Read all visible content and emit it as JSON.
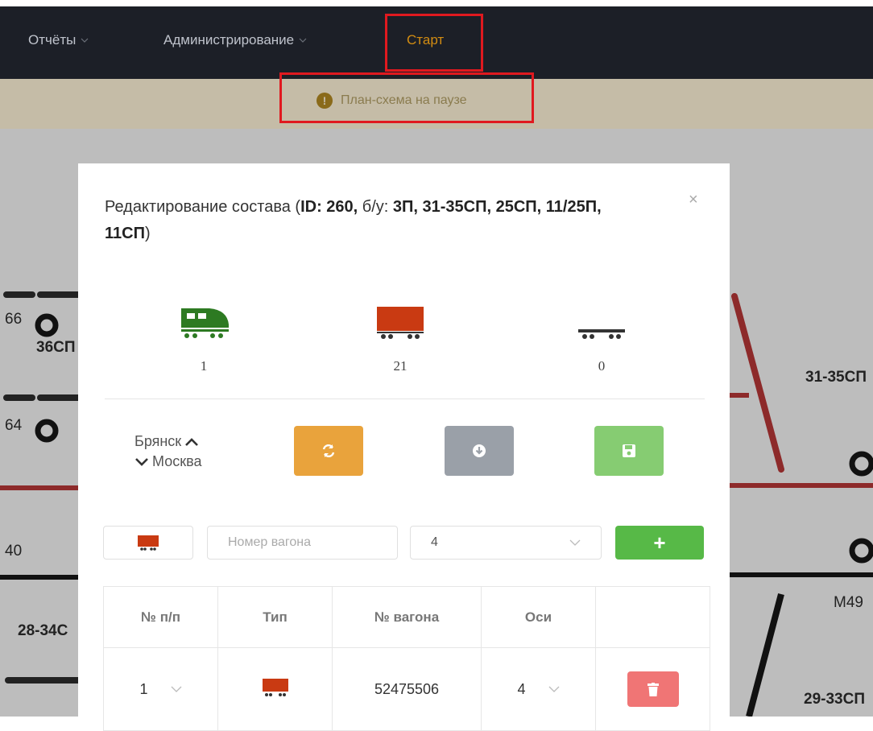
{
  "nav": {
    "reports": "Отчёты",
    "admin": "Администрирование",
    "start": "Старт"
  },
  "pause": {
    "text": "План-схема на паузе",
    "icon": "exclamation-circle-icon",
    "mark": "!"
  },
  "scheme_labels": {
    "l66": "66",
    "l36": "36СП",
    "l64": "64",
    "l40": "40",
    "l2834": "28-34С",
    "l3135": "31-35СП",
    "lm49": "М49",
    "l2933": "29-33СП"
  },
  "modal": {
    "title_prefix": "Редактирование состава (",
    "id_label": "ID: 260,",
    "bu_label": " б/у: ",
    "tracks": "3П, 31-35СП, 25СП, 11/25П,",
    "tracks2": "11СП",
    "title_suffix": ")",
    "close": "×",
    "counts": {
      "locomotive": "1",
      "wagon": "21",
      "platform": "0"
    },
    "route": {
      "from": "Брянск",
      "to": "Москва"
    },
    "buttons": {
      "refresh_icon": "refresh-icon",
      "download_icon": "download-icon",
      "save_icon": "save-icon"
    },
    "form": {
      "wagon_number_placeholder": "Номер вагона",
      "axles_value": "4",
      "add_label": "+"
    },
    "table": {
      "headers": [
        "№ п/п",
        "Тип",
        "№ вагона",
        "Оси",
        ""
      ],
      "rows": [
        {
          "num": "1",
          "wagon_number": "52475506",
          "axles": "4"
        }
      ]
    }
  },
  "colors": {
    "nav_bg": "#1c1f27",
    "accent_orange": "#e9a33c",
    "green": "#57b947",
    "wagon_red": "#c93a12",
    "loco_green": "#2d7a22",
    "highlight_red": "#e0191f"
  }
}
